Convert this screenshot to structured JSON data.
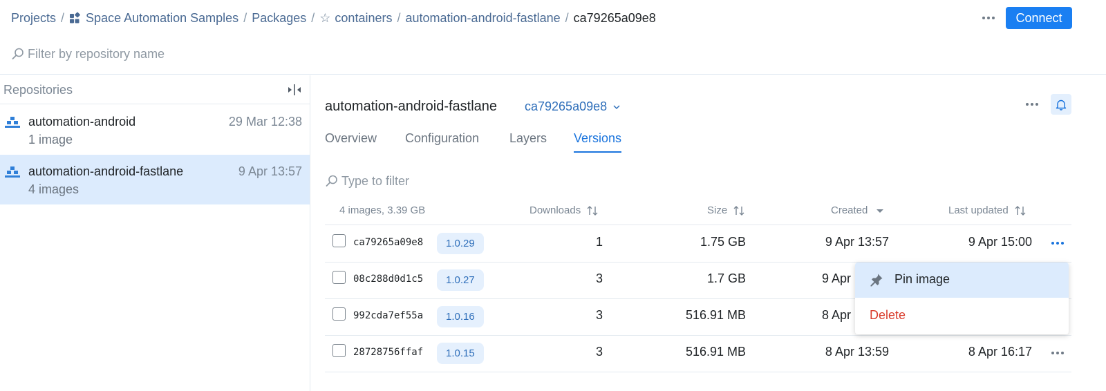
{
  "breadcrumb": {
    "items": [
      "Projects",
      "Space Automation Samples",
      "Packages",
      "containers",
      "automation-android-fastlane"
    ],
    "current": "ca79265a09e8",
    "separator": "/"
  },
  "header": {
    "connect_label": "Connect",
    "filter_placeholder": "Filter by repository name",
    "accent_color": "#1a7ff2"
  },
  "sidebar": {
    "title": "Repositories",
    "repos": [
      {
        "name": "automation-android",
        "count": "1 image",
        "date": "29 Mar 12:38"
      },
      {
        "name": "automation-android-fastlane",
        "count": "4 images",
        "date": "9 Apr 13:57"
      }
    ]
  },
  "main": {
    "title": "automation-android-fastlane",
    "tag": "ca79265a09e8",
    "tabs": [
      "Overview",
      "Configuration",
      "Layers",
      "Versions"
    ],
    "active_tab": "Versions",
    "filter_placeholder": "Type to filter"
  },
  "table": {
    "summary": "4 images, 3.39 GB",
    "columns": [
      "Downloads",
      "Size",
      "Created",
      "Last updated"
    ],
    "rows": [
      {
        "hash": "ca79265a09e8",
        "version": "1.0.29",
        "downloads": "1",
        "size": "1.75 GB",
        "created": "9 Apr 13:57",
        "updated": "9 Apr 15:00"
      },
      {
        "hash": "08c288d0d1c5",
        "version": "1.0.27",
        "downloads": "3",
        "size": "1.7 GB",
        "created": "9 Apr",
        "updated": ""
      },
      {
        "hash": "992cda7ef55a",
        "version": "1.0.16",
        "downloads": "3",
        "size": "516.91 MB",
        "created": "8 Apr",
        "updated": ""
      },
      {
        "hash": "28728756ffaf",
        "version": "1.0.15",
        "downloads": "3",
        "size": "516.91 MB",
        "created": "8 Apr 13:59",
        "updated": "8 Apr 16:17"
      }
    ]
  },
  "context_menu": {
    "items": [
      "Pin image",
      "Delete"
    ],
    "delete_color": "#d93b2b"
  },
  "icons": [
    "search-icon",
    "grid-icon",
    "star-icon",
    "collapse-icon",
    "repository-icon",
    "chevron-down-icon",
    "bell-icon",
    "sort-icon",
    "pin-icon",
    "more-icon"
  ]
}
